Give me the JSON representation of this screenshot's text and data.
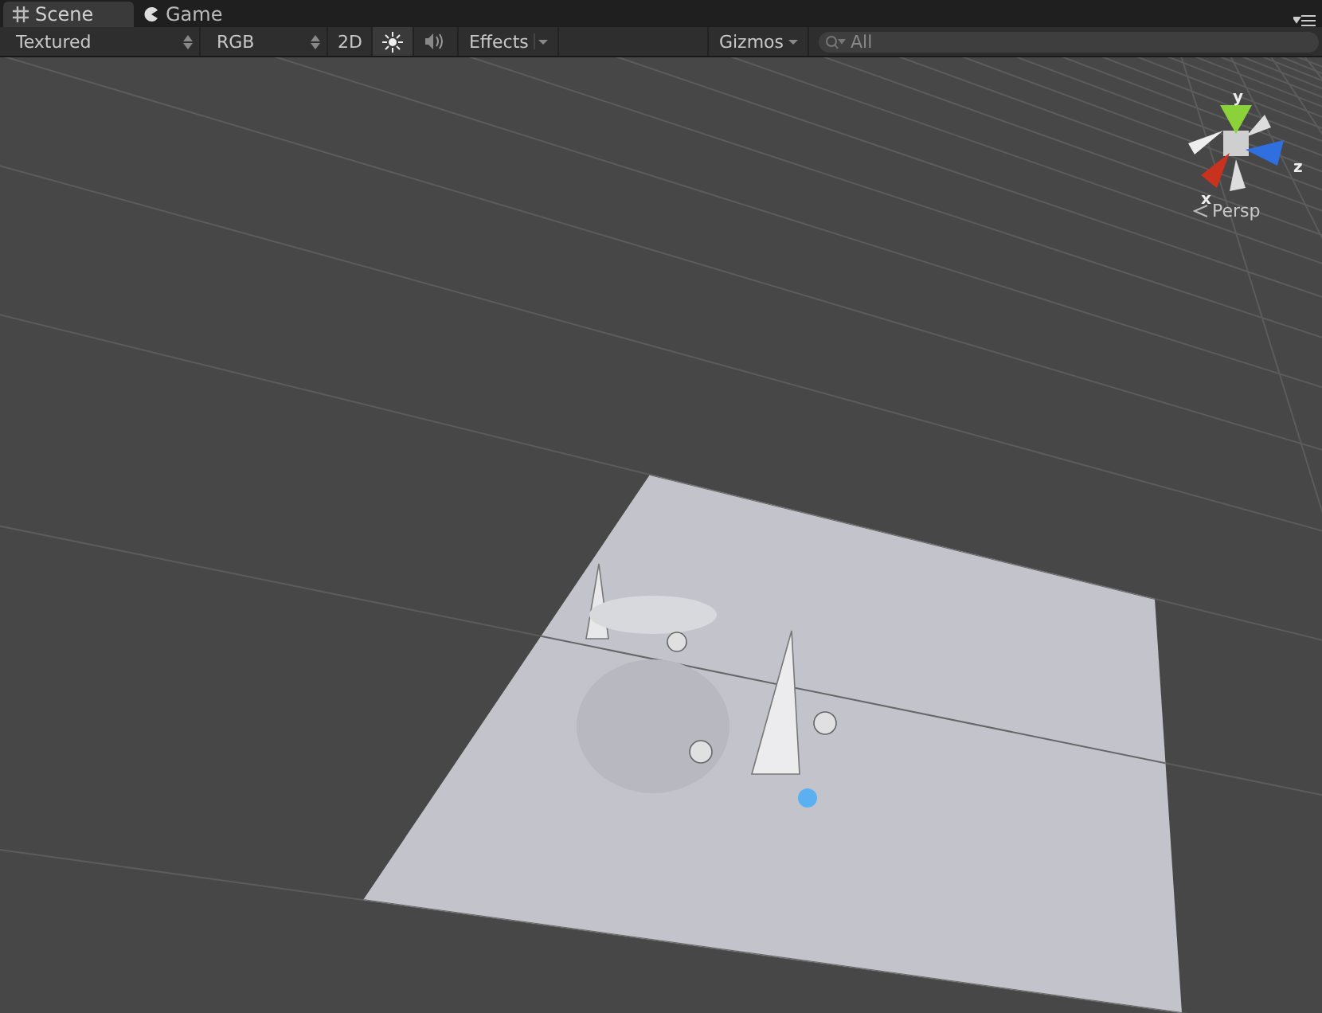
{
  "tabs": [
    {
      "label": "Scene",
      "kind": "scene",
      "selected": true
    },
    {
      "label": "Game",
      "kind": "game",
      "selected": false
    }
  ],
  "toolbar": {
    "draw_mode": "Textured",
    "render_mode": "RGB",
    "mode_2d": "2D",
    "mode_2d_on": false,
    "lighting_on": true,
    "audio_on": false,
    "effects": "Effects",
    "gizmos": "Gizmos",
    "search": {
      "placeholder": "All"
    }
  },
  "view_gizmo": {
    "axes": [
      {
        "label": "y",
        "kind": "y"
      },
      {
        "label": "z",
        "kind": "z"
      },
      {
        "label": "x",
        "kind": "x"
      }
    ],
    "projection": "Persp"
  }
}
